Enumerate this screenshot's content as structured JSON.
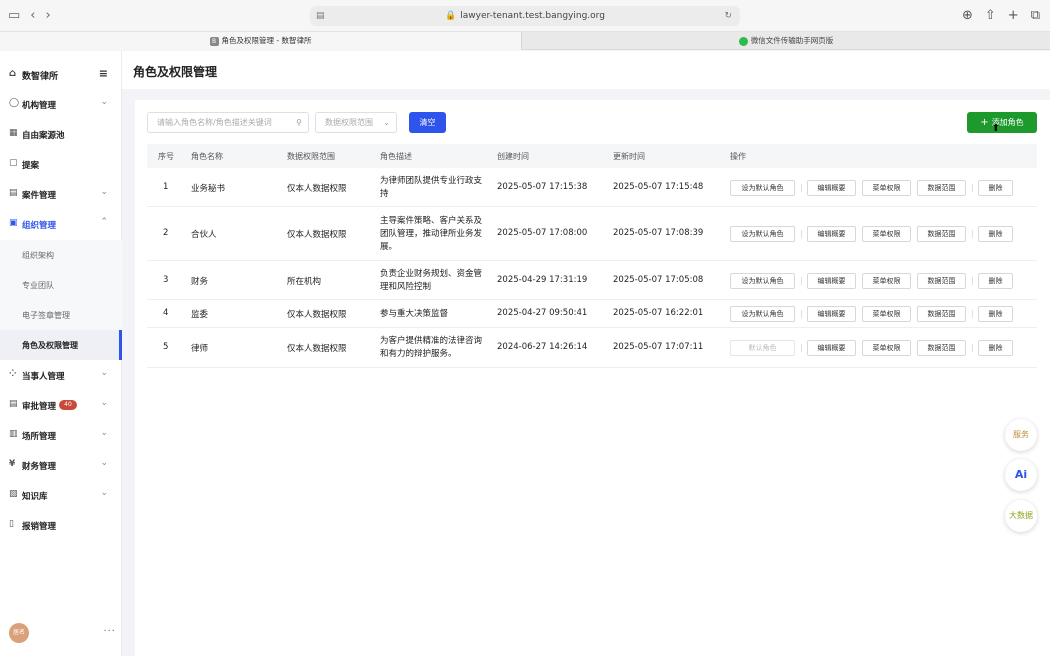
{
  "browser": {
    "url": "lawyer-tenant.test.bangying.org",
    "tabs": [
      {
        "label": "角色及权限管理 - 数智律所",
        "favicon": "B"
      },
      {
        "label": "微信文件传输助手网页版",
        "favicon": ""
      }
    ]
  },
  "sidebar": {
    "brand": "数智律所",
    "items": [
      {
        "label": "机构管理"
      },
      {
        "label": "自由案源池"
      },
      {
        "label": "提案"
      },
      {
        "label": "案件管理"
      },
      {
        "label": "组织管理"
      },
      {
        "label": "当事人管理"
      },
      {
        "label": "审批管理",
        "badge": "40"
      },
      {
        "label": "场所管理"
      },
      {
        "label": "财务管理"
      },
      {
        "label": "知识库"
      },
      {
        "label": "报销管理"
      }
    ],
    "subitems": [
      {
        "label": "组织架构"
      },
      {
        "label": "专业团队"
      },
      {
        "label": "电子签章管理"
      },
      {
        "label": "角色及权限管理"
      }
    ],
    "avatar_text": "居名"
  },
  "page": {
    "title": "角色及权限管理"
  },
  "toolbar": {
    "search_placeholder": "请输入角色名称/角色描述关键词",
    "scope_placeholder": "数据权限范围",
    "clear_label": "清空",
    "add_label": "添加角色"
  },
  "table": {
    "headers": {
      "index": "序号",
      "name": "角色名称",
      "scope": "数据权限范围",
      "desc": "角色描述",
      "created": "创建时间",
      "updated": "更新时间",
      "ops": "操作"
    },
    "rows": [
      {
        "index": "1",
        "name": "业务秘书",
        "scope": "仅本人数据权限",
        "desc": "为律师团队提供专业行政支持",
        "created": "2025-05-07 17:15:38",
        "updated": "2025-05-07 17:15:48",
        "default_label": "设为默认角色",
        "default_disabled": false
      },
      {
        "index": "2",
        "name": "合伙人",
        "scope": "仅本人数据权限",
        "desc": "主导案件策略、客户关系及团队管理，推动律所业务发展。",
        "created": "2025-05-07 17:08:00",
        "updated": "2025-05-07 17:08:39",
        "default_label": "设为默认角色",
        "default_disabled": false
      },
      {
        "index": "3",
        "name": "财务",
        "scope": "所在机构",
        "desc": "负责企业财务规划、资金管理和风险控制",
        "created": "2025-04-29 17:31:19",
        "updated": "2025-05-07 17:05:08",
        "default_label": "设为默认角色",
        "default_disabled": false
      },
      {
        "index": "4",
        "name": "监委",
        "scope": "仅本人数据权限",
        "desc": "参与重大决策监督",
        "created": "2025-04-27 09:50:41",
        "updated": "2025-05-07 16:22:01",
        "default_label": "设为默认角色",
        "default_disabled": false
      },
      {
        "index": "5",
        "name": "律师",
        "scope": "仅本人数据权限",
        "desc": "为客户提供精准的法律咨询和有力的辩护服务。",
        "created": "2024-06-27 14:26:14",
        "updated": "2025-05-07 17:07:11",
        "default_label": "默认角色",
        "default_disabled": true
      }
    ],
    "ops_labels": {
      "edit": "编辑概要",
      "menu": "菜单权限",
      "scope": "数据范围",
      "delete": "删除"
    }
  },
  "floating": {
    "service": "服务",
    "ai": "Ai",
    "bigdata": "大数据"
  },
  "colors": {
    "primary": "#2f54eb",
    "add_button": "#1e9a2c",
    "badge": "#c94a3a"
  }
}
